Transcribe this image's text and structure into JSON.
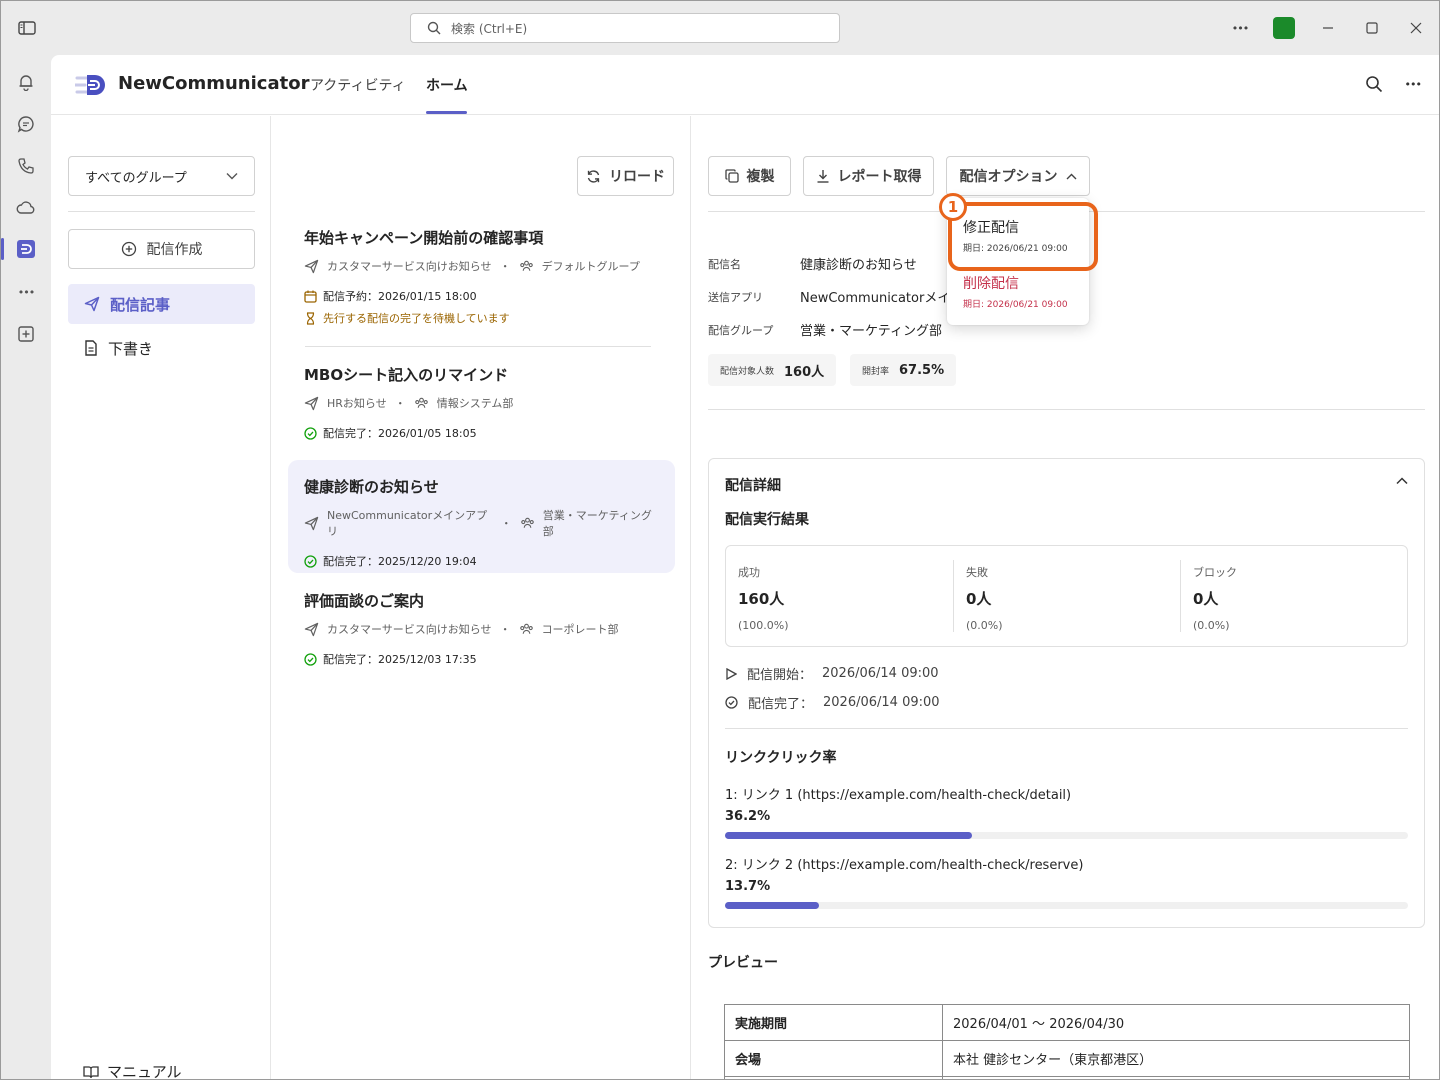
{
  "titlebar": {
    "search_placeholder": "検索 (Ctrl+E)",
    "more": "•••"
  },
  "app": {
    "name": "NewCommunicator",
    "tabs": [
      {
        "label": "アクティビティ"
      },
      {
        "label": "ホーム",
        "active": true
      }
    ],
    "accent": "#5b5fc7"
  },
  "sidebar": {
    "group_select": "すべてのグループ",
    "create_label": "配信作成",
    "items": [
      {
        "label": "配信記事",
        "active": true
      },
      {
        "label": "下書き"
      }
    ],
    "manual_label": "マニュアル"
  },
  "list": {
    "reload_label": "リロード",
    "posts": [
      {
        "title": "年始キャンペーン開始前の確認事項",
        "app": "カスタマーサービス向けお知らせ",
        "group": "デフォルトグループ",
        "status": "配信予約：2026/01/15 18:00",
        "warning": "先行する配信の完了を待機しています"
      },
      {
        "title": "MBOシート記入のリマインド",
        "app": "HRお知らせ",
        "group": "情報システム部",
        "status": "配信完了：2026/01/05 18:05"
      },
      {
        "title": "健康診断のお知らせ",
        "app": "NewCommunicatorメインアプリ",
        "group": "営業・マーケティング部",
        "status": "配信完了：2025/12/20 19:04",
        "selected": true
      },
      {
        "title": "評価面談のご案内",
        "app": "カスタマーサービス向けお知らせ",
        "group": "コーポレート部",
        "status": "配信完了：2025/12/03 17:35"
      }
    ]
  },
  "detail": {
    "toolbar": {
      "duplicate": "複製",
      "report": "レポート取得",
      "options": "配信オプション"
    },
    "fields": [
      {
        "label": "配信名",
        "value": "健康診断のお知らせ"
      },
      {
        "label": "送信アプリ",
        "value": "NewCommunicatorメインアプリ"
      },
      {
        "label": "配信グループ",
        "value": "営業・マーケティング部"
      }
    ],
    "target_label": "配信対象人数",
    "target_value": "160人",
    "open_label": "開封率",
    "open_value": "67.5%",
    "section_title": "配信詳細",
    "result_title": "配信実行結果",
    "stats": [
      {
        "label": "成功",
        "value": "160人",
        "pct": "(100.0%)"
      },
      {
        "label": "失敗",
        "value": "0人",
        "pct": "(0.0%)"
      },
      {
        "label": "ブロック",
        "value": "0人",
        "pct": "(0.0%)"
      }
    ],
    "start_label": "配信開始：",
    "start_value": "2026/06/14 09:00",
    "end_label": "配信完了：",
    "end_value": "2026/06/14 09:00",
    "link_title": "リンククリック率",
    "links": [
      {
        "label": "1: リンク 1 (https://example.com/health-check/detail)",
        "rate": "36.2%",
        "fraction": 0.362
      },
      {
        "label": "2: リンク 2 (https://example.com/health-check/reserve)",
        "rate": "13.7%",
        "fraction": 0.137
      }
    ],
    "preview_title": "プレビュー",
    "preview_rows": [
      {
        "key": "実施期間",
        "value": "2026/04/01 〜 2026/04/30"
      },
      {
        "key": "会場",
        "value": "本社 健診センター（東京都港区）"
      }
    ]
  },
  "dropdown": {
    "items": [
      {
        "label": "修正配信",
        "sub": "期日: 2026/06/21 09:00"
      },
      {
        "label": "削除配信",
        "sub": "期日: 2026/06/21 09:00",
        "danger": true
      }
    ]
  },
  "annotation": {
    "marker": "1",
    "color": "#e8641b"
  }
}
